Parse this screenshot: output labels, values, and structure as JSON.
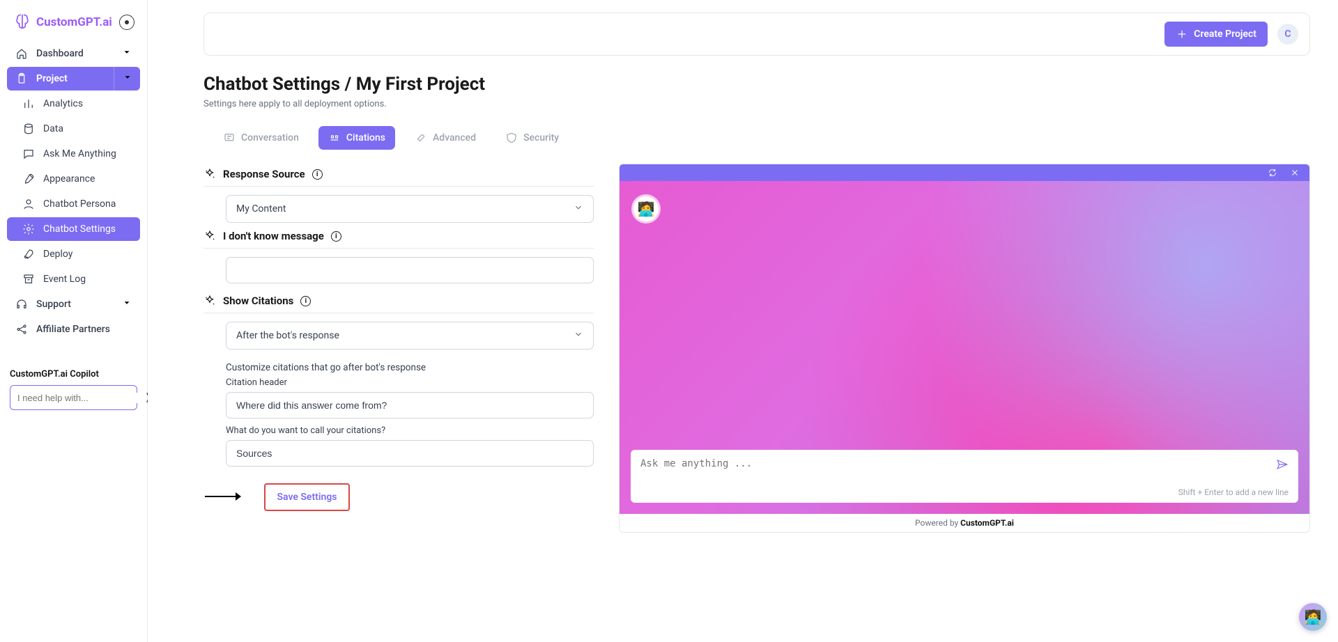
{
  "brand": "CustomGPT.ai",
  "sidebar": {
    "items": {
      "dashboard": "Dashboard",
      "project": "Project",
      "analytics": "Analytics",
      "data": "Data",
      "ask": "Ask Me Anything",
      "appearance": "Appearance",
      "persona": "Chatbot Persona",
      "settings": "Chatbot Settings",
      "deploy": "Deploy",
      "eventlog": "Event Log",
      "support": "Support",
      "affiliate": "Affiliate Partners"
    },
    "copilot_title": "CustomGPT.ai Copilot",
    "copilot_placeholder": "I need help with..."
  },
  "topbar": {
    "create": "Create Project",
    "avatar": "C"
  },
  "page": {
    "title": "Chatbot Settings / My First Project",
    "subtitle": "Settings here apply to all deployment options."
  },
  "tabs": {
    "conversation": "Conversation",
    "citations": "Citations",
    "advanced": "Advanced",
    "security": "Security"
  },
  "settings": {
    "response_source_title": "Response Source",
    "response_source_value": "My Content",
    "idk_title": "I don't know message",
    "idk_value": "",
    "show_citations_title": "Show Citations",
    "show_citations_value": "After the bot's response",
    "customize_help": "Customize citations that go after bot's response",
    "citation_header_label": "Citation header",
    "citation_header_value": "Where did this answer come from?",
    "citation_name_label": "What do you want to call your citations?",
    "citation_name_value": "Sources",
    "save_button": "Save Settings"
  },
  "preview": {
    "placeholder": "Ask me anything ...",
    "hint": "Shift + Enter to add a new line",
    "powered_prefix": "Powered by ",
    "powered_brand": "CustomGPT.ai"
  }
}
